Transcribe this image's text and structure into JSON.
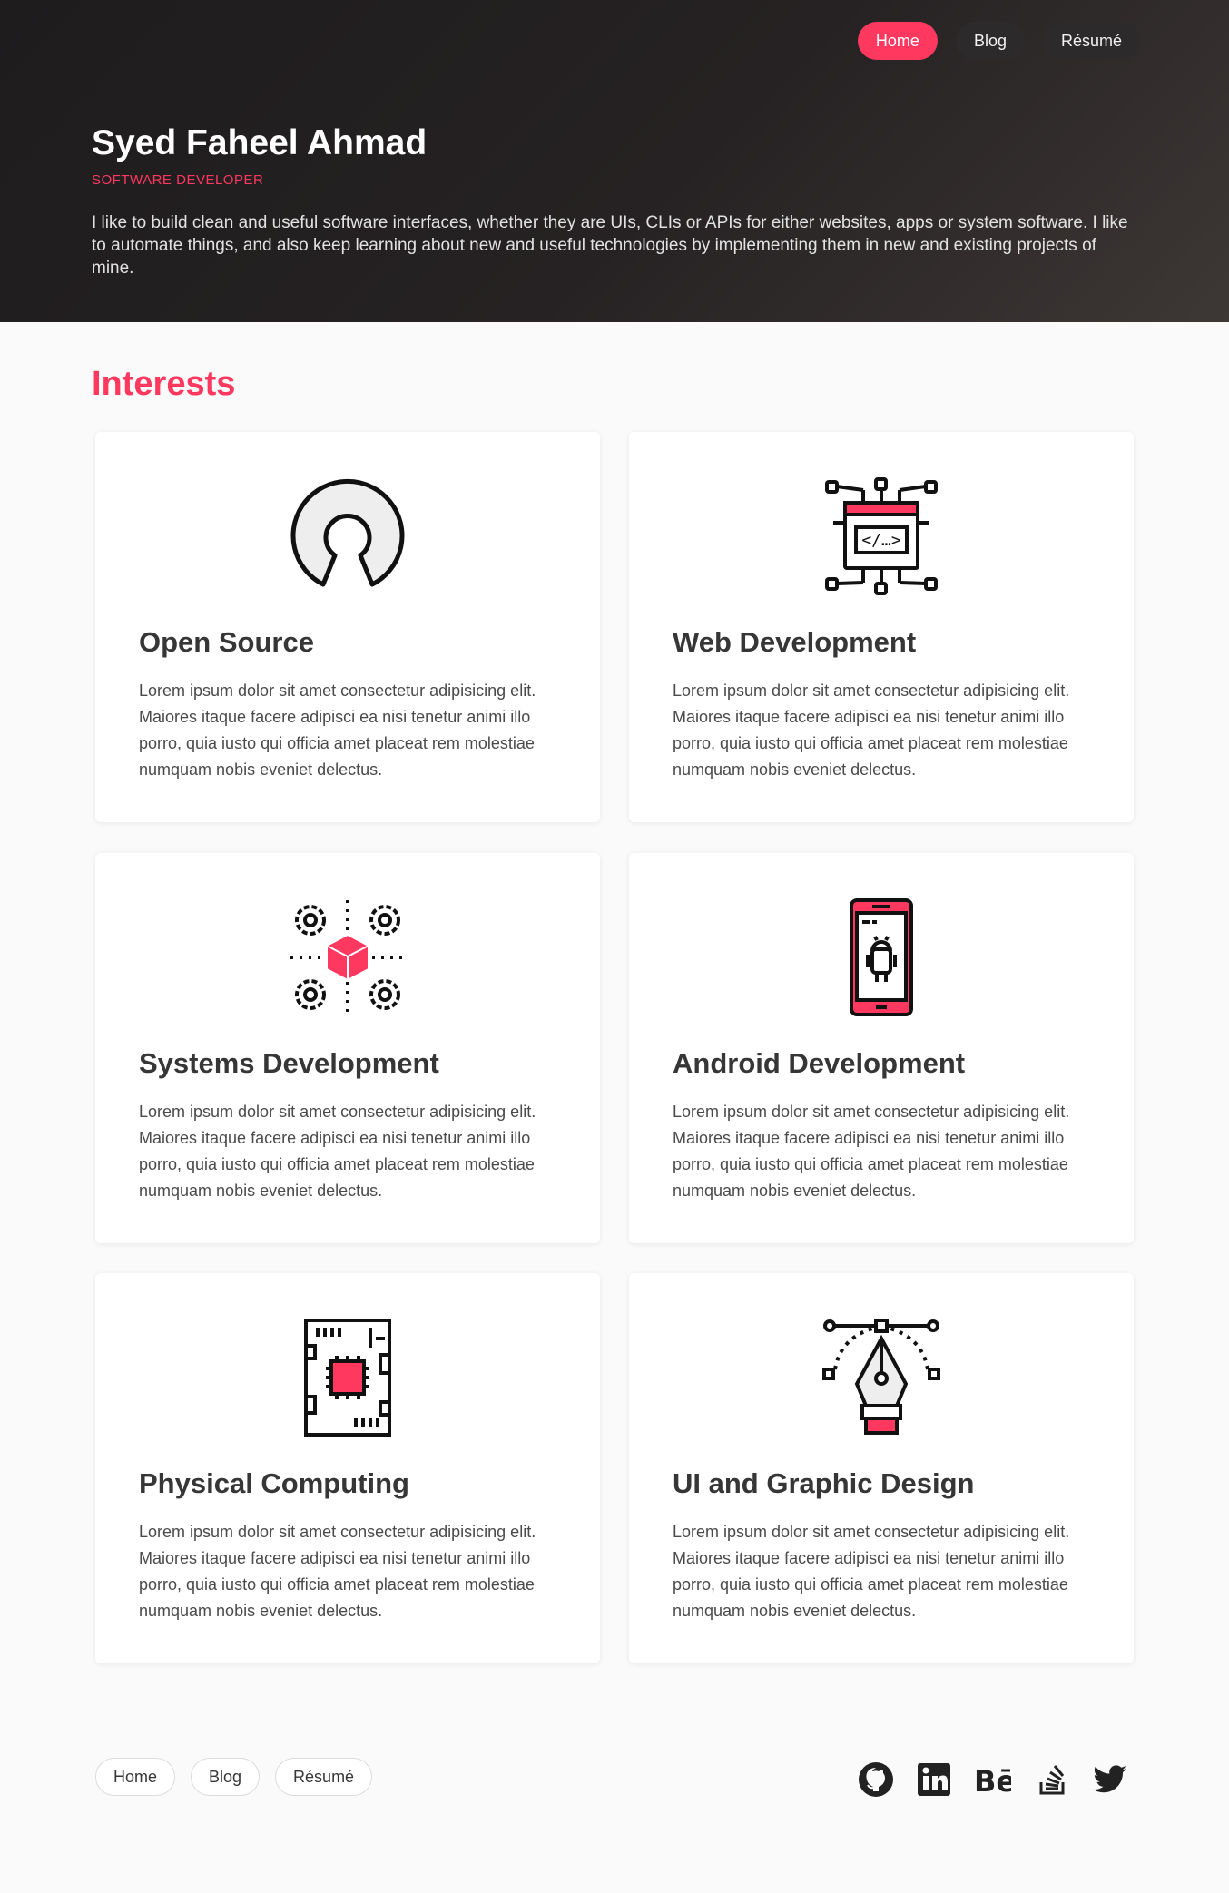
{
  "nav": {
    "items": [
      {
        "label": "Home",
        "active": true
      },
      {
        "label": "Blog",
        "active": false
      },
      {
        "label": "Résumé",
        "active": false
      }
    ]
  },
  "hero": {
    "name": "Syed Faheel Ahmad",
    "role": "SOFTWARE DEVELOPER",
    "bio": "I like to build clean and useful software interfaces, whether they are UIs, CLIs or APIs for either websites, apps or system software. I like to automate things, and also keep learning about new and useful technologies by implementing them in new and existing projects of mine."
  },
  "interests": {
    "title": "Interests",
    "cards": [
      {
        "icon": "open-source-icon",
        "title": "Open Source",
        "text": "Lorem ipsum dolor sit amet consectetur adipisicing elit. Maiores itaque facere adipisci ea nisi tenetur animi illo porro, quia iusto qui officia amet placeat rem molestiae numquam nobis eveniet delectus."
      },
      {
        "icon": "web-development-icon",
        "title": "Web Development",
        "text": "Lorem ipsum dolor sit amet consectetur adipisicing elit. Maiores itaque facere adipisci ea nisi tenetur animi illo porro, quia iusto qui officia amet placeat rem molestiae numquam nobis eveniet delectus."
      },
      {
        "icon": "systems-development-icon",
        "title": "Systems Development",
        "text": "Lorem ipsum dolor sit amet consectetur adipisicing elit. Maiores itaque facere adipisci ea nisi tenetur animi illo porro, quia iusto qui officia amet placeat rem molestiae numquam nobis eveniet delectus."
      },
      {
        "icon": "android-phone-icon",
        "title": "Android Development",
        "text": "Lorem ipsum dolor sit amet consectetur adipisicing elit. Maiores itaque facere adipisci ea nisi tenetur animi illo porro, quia iusto qui officia amet placeat rem molestiae numquam nobis eveniet delectus."
      },
      {
        "icon": "circuit-board-icon",
        "title": "Physical Computing",
        "text": "Lorem ipsum dolor sit amet consectetur adipisicing elit. Maiores itaque facere adipisci ea nisi tenetur animi illo porro, quia iusto qui officia amet placeat rem molestiae numquam nobis eveniet delectus."
      },
      {
        "icon": "pen-tool-icon",
        "title": "UI and Graphic Design",
        "text": "Lorem ipsum dolor sit amet consectetur adipisicing elit. Maiores itaque facere adipisci ea nisi tenetur animi illo porro, quia iusto qui officia amet placeat rem molestiae numquam nobis eveniet delectus."
      }
    ]
  },
  "footer": {
    "nav": [
      "Home",
      "Blog",
      "Résumé"
    ],
    "social": [
      "github-icon",
      "linkedin-icon",
      "behance-icon",
      "stackoverflow-icon",
      "twitter-icon"
    ]
  },
  "colors": {
    "accent": "#ff3860",
    "hero_bg": "#1e1c1d",
    "page_bg": "#fafafa",
    "text": "#363636"
  }
}
